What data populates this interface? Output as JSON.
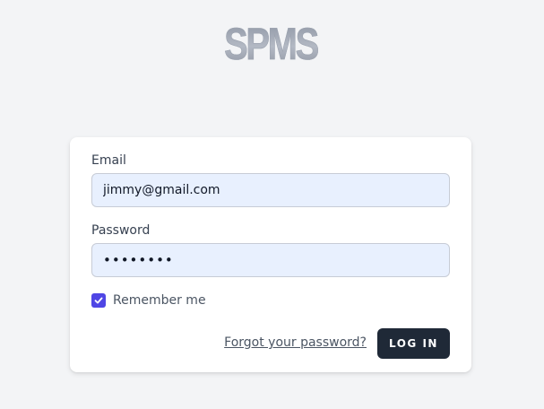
{
  "app": {
    "logo_text": "SPMS"
  },
  "login_form": {
    "email_label": "Email",
    "email_value": "jimmy@gmail.com",
    "password_label": "Password",
    "password_value": "••••••••",
    "remember_label": "Remember me",
    "remember_checked": true,
    "forgot_link": "Forgot your password?",
    "login_button": "LOG IN"
  },
  "colors": {
    "background": "#f3f4f6",
    "card": "#ffffff",
    "input_fill": "#e8f0fe",
    "checkbox": "#4f46e5",
    "button": "#1f2937"
  },
  "icons": {
    "checkbox_icon": "check-icon"
  }
}
